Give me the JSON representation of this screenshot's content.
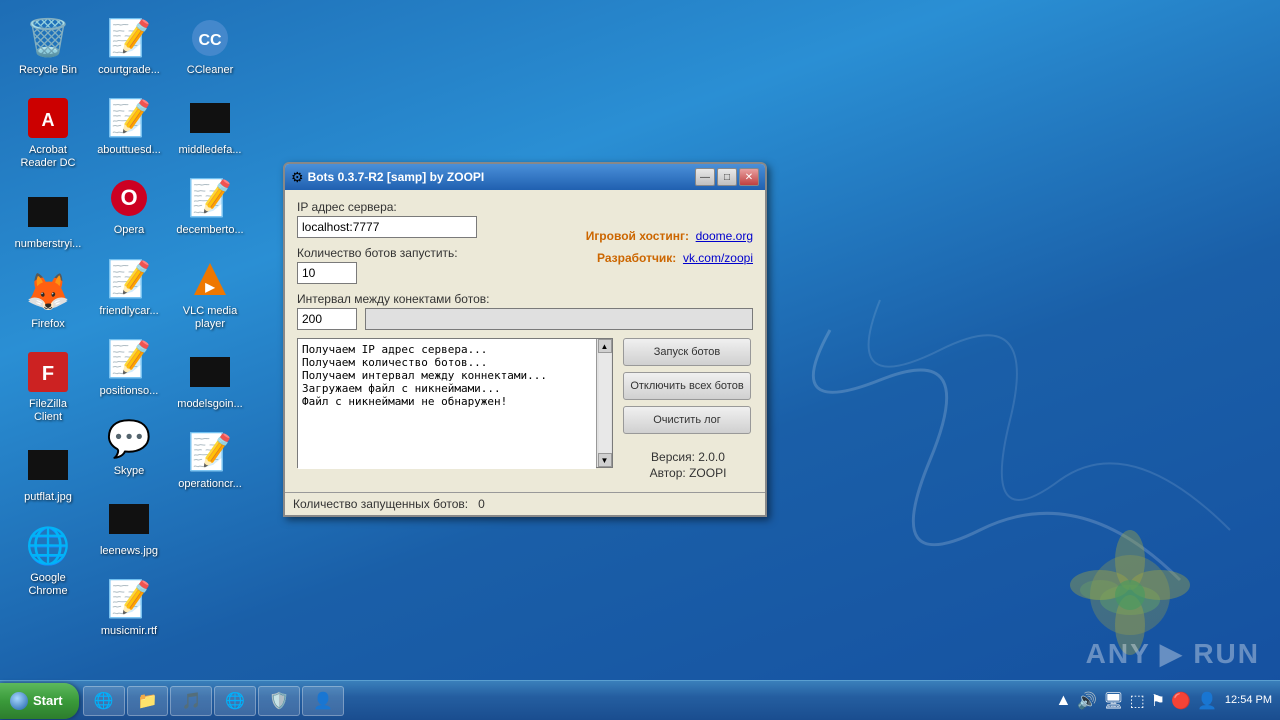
{
  "desktop": {
    "background_color": "#1a5fa8"
  },
  "desktop_icons": [
    {
      "id": "recycle-bin",
      "label": "Recycle Bin",
      "icon": "🗑️"
    },
    {
      "id": "acrobat",
      "label": "Acrobat Reader DC",
      "icon": "📄"
    },
    {
      "id": "numberstring",
      "label": "numberstryi...",
      "icon": "⬛"
    },
    {
      "id": "firefox",
      "label": "Firefox",
      "icon": "🦊"
    },
    {
      "id": "filezilla",
      "label": "FileZilla Client",
      "icon": "🗂️"
    },
    {
      "id": "putflat",
      "label": "putflat.jpg",
      "icon": "⬛"
    },
    {
      "id": "chrome",
      "label": "Google Chrome",
      "icon": "🌐"
    },
    {
      "id": "courtgrade",
      "label": "courtgrade...",
      "icon": "📝"
    },
    {
      "id": "abouttuesd",
      "label": "abouttuesd...",
      "icon": "📝"
    },
    {
      "id": "opera",
      "label": "Opera",
      "icon": "🅾"
    },
    {
      "id": "friendlycar",
      "label": "friendlycar...",
      "icon": "📝"
    },
    {
      "id": "positionso",
      "label": "positionso...",
      "icon": "📝"
    },
    {
      "id": "skype",
      "label": "Skype",
      "icon": "💬"
    },
    {
      "id": "leenews",
      "label": "leenews.jpg",
      "icon": "⬛"
    },
    {
      "id": "musicmir",
      "label": "musicmir.rtf",
      "icon": "📝"
    },
    {
      "id": "ccleaner",
      "label": "CCleaner",
      "icon": "🧹"
    },
    {
      "id": "middledefa",
      "label": "middledefa...",
      "icon": "⬛"
    },
    {
      "id": "decemberto",
      "label": "decemberto...",
      "icon": "📝"
    },
    {
      "id": "vlc",
      "label": "VLC media player",
      "icon": "🎵"
    },
    {
      "id": "modelsgoin",
      "label": "modelsgoin...",
      "icon": "⬛"
    },
    {
      "id": "operationcr",
      "label": "operationcr...",
      "icon": "📝"
    }
  ],
  "taskbar": {
    "start_label": "Start",
    "items": [
      {
        "label": "IE",
        "icon": "🌐"
      },
      {
        "label": "Explorer",
        "icon": "📁"
      },
      {
        "label": "WMP",
        "icon": "🎵"
      },
      {
        "label": "Chrome",
        "icon": "🌐"
      },
      {
        "label": "Avira",
        "icon": "🛡️"
      },
      {
        "label": "User",
        "icon": "👤"
      }
    ],
    "clock": "12:54 PM"
  },
  "dialog": {
    "title": "Bots 0.3.7-R2 [samp] by ZOOPI",
    "server_ip_label": "IP адрес сервера:",
    "server_ip_value": "localhost:7777",
    "bot_count_label": "Количество ботов запустить:",
    "bot_count_value": "10",
    "interval_label": "Интервал между конектами ботов:",
    "interval_value": "200",
    "hosting_label": "Игровой хостинг:",
    "hosting_link": "doome.org",
    "developer_label": "Разработчик:",
    "developer_link": "vk.com/zoopi",
    "log_lines": [
      "Получаем IP адрес сервера...",
      "Получаем количество ботов...",
      "Получаем интервал между коннектами...",
      "Загружаем файл с никнеймами...",
      "Файл с никнеймами не обнаружен!"
    ],
    "btn_start": "Запуск ботов",
    "btn_stop": "Отключить всех ботов",
    "btn_clear": "Очистить лог",
    "version_label": "Версия:  2.0.0",
    "author_label": "Автор: ZOOPI",
    "status_label": "Количество запущенных ботов:",
    "status_value": "0"
  },
  "anyrun": {
    "logo": "ANY ▶ RUN"
  }
}
